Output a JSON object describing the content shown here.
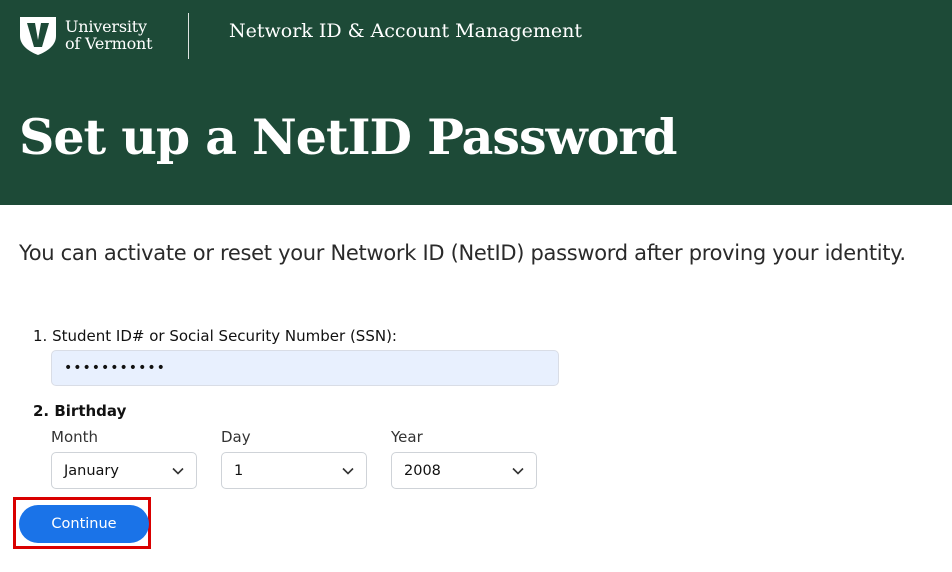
{
  "header": {
    "logo_line1": "University",
    "logo_line2": "of Vermont",
    "app_title": "Network ID & Account Management",
    "page_title": "Set up a NetID Password",
    "brand_color": "#1d4a37"
  },
  "intro": "You can activate or reset your Network ID (NetID) password after proving your identity.",
  "form": {
    "q1_label": "1. Student ID# or Social Security Number (SSN):",
    "ssn_value": "•••••••••••",
    "q2_label": "2. Birthday",
    "month_label": "Month",
    "month_value": "January",
    "day_label": "Day",
    "day_value": "1",
    "year_label": "Year",
    "year_value": "2008",
    "continue_label": "Continue",
    "highlight_color": "#d90000",
    "button_color": "#1a73e8"
  },
  "icons": {
    "logo": "uvm-shield-icon",
    "select": "chevron-down-icon"
  }
}
